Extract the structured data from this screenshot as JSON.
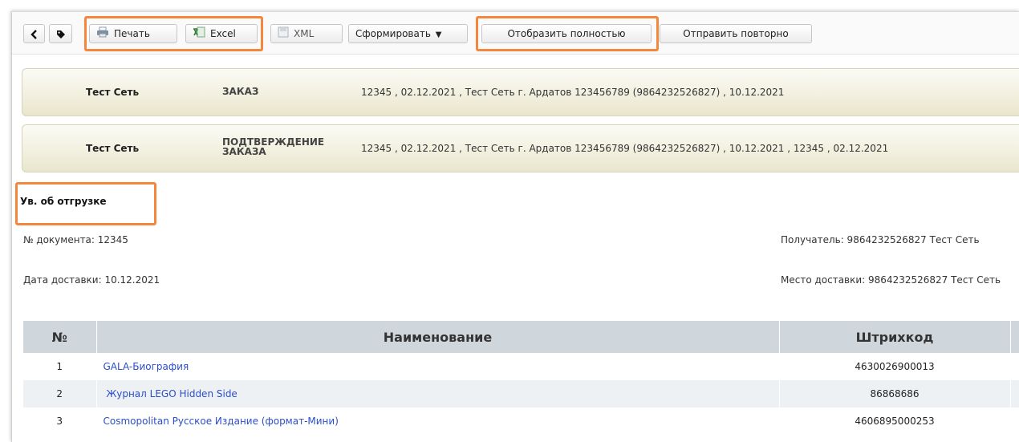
{
  "toolbar": {
    "print_label": "Печать",
    "excel_label": "Excel",
    "xml_label": "XML",
    "form_label": "Сформировать",
    "show_full_label": "Отобразить полностью",
    "resend_label": "Отправить повторно"
  },
  "documents": [
    {
      "network": "Тест Сеть",
      "type_line1": "ЗАКАЗ",
      "type_line2": "",
      "details": "12345 , 02.12.2021 , Тест Сеть г. Ардатов 123456789 (9864232526827) , 10.12.2021"
    },
    {
      "network": "Тест Сеть",
      "type_line1": "ПОДТВЕРЖДЕНИЕ",
      "type_line2": "ЗАКАЗА",
      "details": "12345 , 02.12.2021 , Тест Сеть г. Ардатов 123456789 (9864232526827) , 10.12.2021 , 12345 , 02.12.2021"
    }
  ],
  "section_title": "Ув. об отгрузке",
  "meta": {
    "doc_number": "№ документа: 12345",
    "delivery_date": "Дата доставки: 10.12.2021",
    "recipient": "Получатель: 9864232526827 Тест Сеть",
    "delivery_place": "Место доставки: 9864232526827 Тест Сеть"
  },
  "table": {
    "headers": [
      "№",
      "Наименование",
      "Штрихкод"
    ],
    "rows": [
      {
        "num": "1",
        "name": "GALA-Биография",
        "barcode": "4630026900013"
      },
      {
        "num": "2",
        "name": " Журнал LEGO Hidden Side",
        "barcode": "86868686"
      },
      {
        "num": "3",
        "name": "Cosmopolitan Русское Издание (формат-Мини)",
        "barcode": "4606895000253"
      }
    ]
  },
  "colors": {
    "highlight": "#f5873d",
    "link": "#2c4ec9",
    "header_bg": "#cfd6dc",
    "card_bg": "#f1efdd"
  },
  "icons": [
    "back-arrow-icon",
    "tag-icon",
    "printer-icon",
    "excel-icon",
    "xml-file-icon",
    "chevron-down-icon"
  ]
}
